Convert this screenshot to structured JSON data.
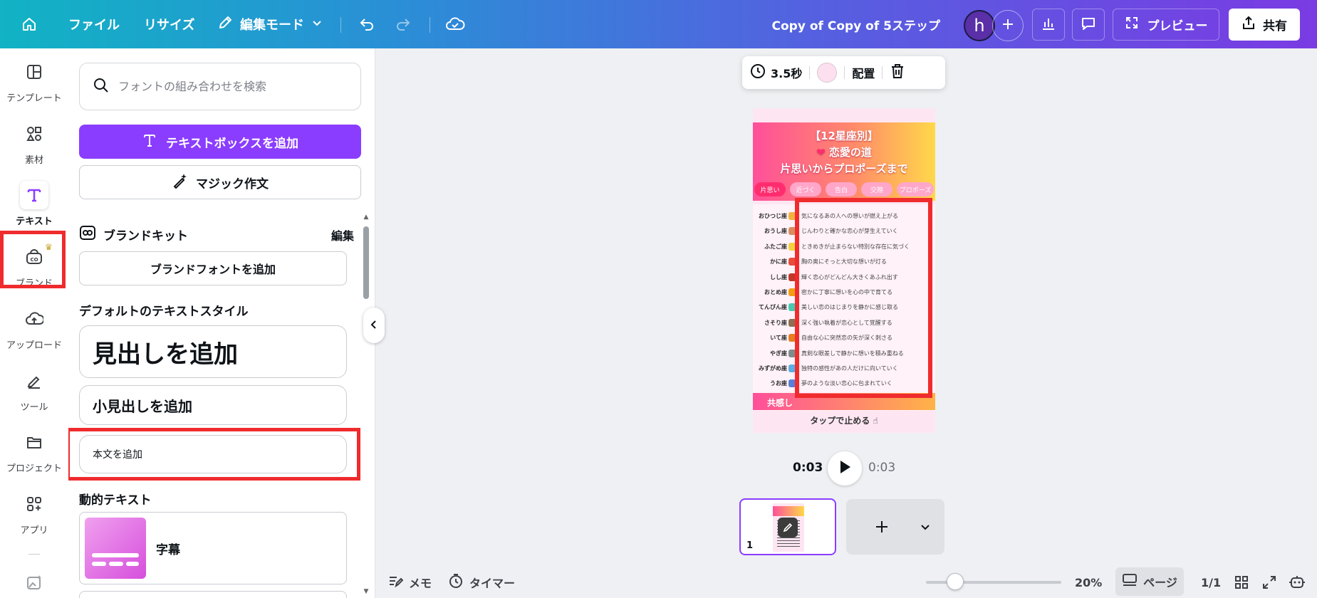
{
  "topbar": {
    "file_label": "ファイル",
    "resize_label": "リサイズ",
    "edit_mode_label": "編集モード",
    "doc_title": "Copy of Copy of 5ステップ",
    "avatar_letter": "h",
    "preview_label": "プレビュー",
    "share_label": "共有"
  },
  "rail": {
    "items": [
      {
        "label": "テンプレート",
        "icon": "template-icon"
      },
      {
        "label": "素材",
        "icon": "elements-icon"
      },
      {
        "label": "テキスト",
        "icon": "text-icon"
      },
      {
        "label": "ブランド",
        "icon": "brand-icon"
      },
      {
        "label": "アップロード",
        "icon": "upload-icon"
      },
      {
        "label": "ツール",
        "icon": "tools-icon"
      },
      {
        "label": "プロジェクト",
        "icon": "project-icon"
      },
      {
        "label": "アプリ",
        "icon": "apps-icon"
      }
    ],
    "active": "テキスト"
  },
  "panel": {
    "search_placeholder": "フォントの組み合わせを検索",
    "add_textbox_label": "テキストボックスを追加",
    "magic_write_label": "マジック作文",
    "brandkit_title": "ブランドキット",
    "brandkit_edit": "編集",
    "add_brand_font_label": "ブランドフォントを追加",
    "default_styles_title": "デフォルトのテキストスタイル",
    "add_heading_label": "見出しを追加",
    "add_subheading_label": "小見出しを追加",
    "add_body_label": "本文を追加",
    "dynamic_text_title": "動的テキスト",
    "caption_label": "字幕"
  },
  "floating_toolbar": {
    "duration": "3.5秒",
    "swatch_color": "#fde0f0",
    "arrange_label": "配置"
  },
  "design": {
    "title_line1": "【12星座別】",
    "title_line2": "恋愛の道",
    "title_line3": "片思いからプロポーズまで",
    "steps": [
      "片思い",
      "近づく",
      "告白",
      "交際",
      "プロポーズ"
    ],
    "signs": [
      {
        "name": "おひつじ座",
        "text": "気になるあの人への想いが燃え上がる",
        "color": "#f5b041"
      },
      {
        "name": "おうし座",
        "text": "じんわりと確かな恋心が芽生えていく",
        "color": "#d98c5f"
      },
      {
        "name": "ふたご座",
        "text": "ときめきが止まらない特別な存在に気づく",
        "color": "#f4d03f"
      },
      {
        "name": "かに座",
        "text": "胸の奥にそっと大切な想いが灯る",
        "color": "#e74c3c"
      },
      {
        "name": "しし座",
        "text": "輝く恋心がどんどん大きくあふれ出す",
        "color": "#c0392b"
      },
      {
        "name": "おとめ座",
        "text": "密かに丁寧に想いを心の中で育てる",
        "color": "#f39c12"
      },
      {
        "name": "てんびん座",
        "text": "美しい恋のはじまりを静かに感じ取る",
        "color": "#48c9b0"
      },
      {
        "name": "さそり座",
        "text": "深く強い執着が恋心として覚醒する",
        "color": "#8e6e53"
      },
      {
        "name": "いて座",
        "text": "自由な心に突然恋の矢が深く刺さる",
        "color": "#e67e22"
      },
      {
        "name": "やぎ座",
        "text": "真剣な眼差しで静かに想いを積み重ねる",
        "color": "#7f8c8d"
      },
      {
        "name": "みずがめ座",
        "text": "独特の感性があの人だけに向いていく",
        "color": "#5dade2"
      },
      {
        "name": "うお座",
        "text": "夢のような淡い恋心に包まれていく",
        "color": "#5b7fd6"
      }
    ],
    "banner_text": "共感し",
    "tap_text": "タップで止める"
  },
  "playback": {
    "current_time": "0:03",
    "total_time": "0:03"
  },
  "pages": {
    "current_page_number": "1"
  },
  "bottombar": {
    "notes_label": "メモ",
    "timer_label": "タイマー",
    "zoom_percent": "20%",
    "zoom_level": 0.2,
    "page_view_label": "ページ",
    "page_count": "1/1"
  }
}
